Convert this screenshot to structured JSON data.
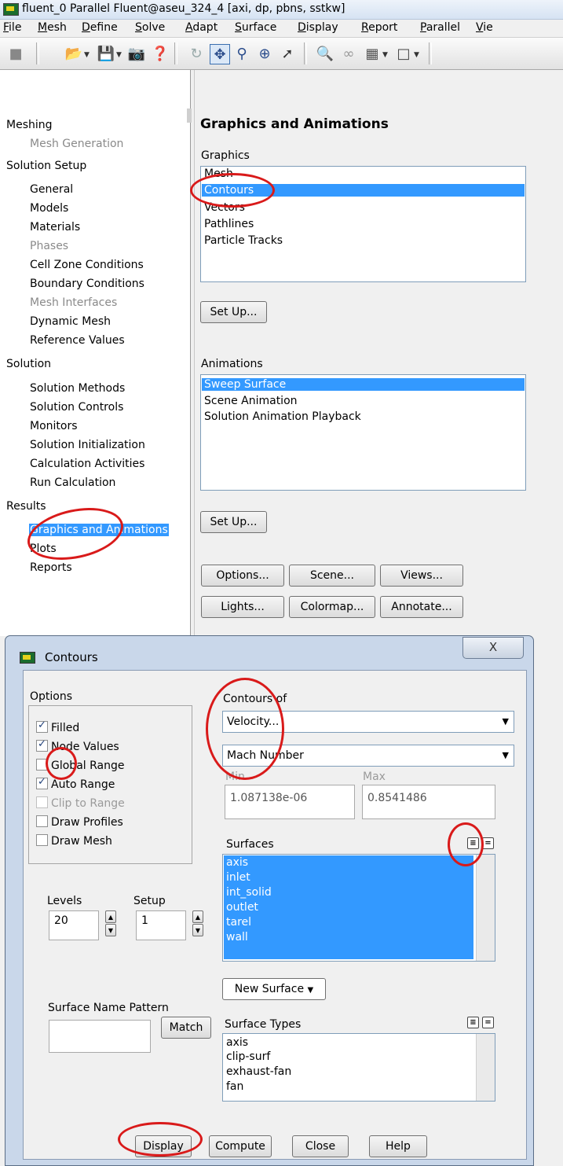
{
  "window": {
    "title": "fluent_0 Parallel Fluent@aseu_324_4  [axi, dp, pbns, sstkw]"
  },
  "menu": [
    "File",
    "Mesh",
    "Define",
    "Solve",
    "Adapt",
    "Surface",
    "Display",
    "Report",
    "Parallel",
    "Vie"
  ],
  "tree": {
    "items": [
      {
        "label": "Meshing",
        "level": 0
      },
      {
        "label": "Mesh Generation",
        "level": 1,
        "disabled": true
      },
      {
        "label": "Solution Setup",
        "level": 0
      },
      {
        "label": "General",
        "level": 1
      },
      {
        "label": "Models",
        "level": 1
      },
      {
        "label": "Materials",
        "level": 1
      },
      {
        "label": "Phases",
        "level": 1,
        "disabled": true
      },
      {
        "label": "Cell Zone Conditions",
        "level": 1
      },
      {
        "label": "Boundary Conditions",
        "level": 1
      },
      {
        "label": "Mesh Interfaces",
        "level": 1,
        "disabled": true
      },
      {
        "label": "Dynamic Mesh",
        "level": 1
      },
      {
        "label": "Reference Values",
        "level": 1
      },
      {
        "label": "Solution",
        "level": 0
      },
      {
        "label": "Solution Methods",
        "level": 1
      },
      {
        "label": "Solution Controls",
        "level": 1
      },
      {
        "label": "Monitors",
        "level": 1
      },
      {
        "label": "Solution Initialization",
        "level": 1
      },
      {
        "label": "Calculation Activities",
        "level": 1
      },
      {
        "label": "Run Calculation",
        "level": 1
      },
      {
        "label": "Results",
        "level": 0
      },
      {
        "label": "Graphics and Animations",
        "level": 1,
        "selected": true
      },
      {
        "label": "Plots",
        "level": 1
      },
      {
        "label": "Reports",
        "level": 1
      }
    ]
  },
  "panel": {
    "title": "Graphics and Animations",
    "graphics_label": "Graphics",
    "graphics_items": [
      "Mesh",
      "Contours",
      "Vectors",
      "Pathlines",
      "Particle Tracks"
    ],
    "graphics_selected": "Contours",
    "setup1": "Set Up...",
    "animations_label": "Animations",
    "animation_items": [
      "Sweep Surface",
      "Scene Animation",
      "Solution Animation Playback"
    ],
    "animations_selected": "Sweep Surface",
    "setup2": "Set Up...",
    "buttons": {
      "options": "Options...",
      "scene": "Scene...",
      "views": "Views...",
      "lights": "Lights...",
      "colormap": "Colormap...",
      "annotate": "Annotate..."
    }
  },
  "dialog": {
    "title": "Contours",
    "close_glyph": "X",
    "options_label": "Options",
    "options": [
      {
        "label": "Filled",
        "checked": true
      },
      {
        "label": "Node Values",
        "checked": true
      },
      {
        "label": "Global Range",
        "checked": false
      },
      {
        "label": "Auto Range",
        "checked": true
      },
      {
        "label": "Clip to Range",
        "checked": false,
        "disabled": true
      },
      {
        "label": "Draw Profiles",
        "checked": false
      },
      {
        "label": "Draw Mesh",
        "checked": false
      }
    ],
    "contours_of_label": "Contours of",
    "contours_of_value": "Velocity...",
    "contours_of_sub": "Mach Number",
    "min_label": "Min",
    "max_label": "Max",
    "min_value": "1.087138e-06",
    "max_value": "0.8541486",
    "surfaces_label": "Surfaces",
    "surfaces": [
      "axis",
      "inlet",
      "int_solid",
      "outlet",
      "tarel",
      "wall"
    ],
    "levels_label": "Levels",
    "levels_value": "20",
    "setup_label": "Setup",
    "setup_value": "1",
    "new_surface": "New Surface",
    "pattern_label": "Surface Name Pattern",
    "match": "Match",
    "surface_types_label": "Surface Types",
    "surface_types": [
      "axis",
      "clip-surf",
      "exhaust-fan",
      "fan"
    ],
    "buttons": {
      "display": "Display",
      "compute": "Compute",
      "close": "Close",
      "help": "Help"
    }
  },
  "colors": {
    "selection": "#3399ff",
    "annotation": "#d91a1a"
  }
}
